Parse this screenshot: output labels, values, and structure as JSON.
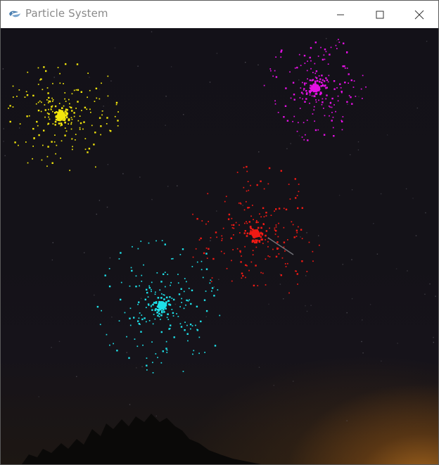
{
  "window": {
    "title": "Particle System",
    "icon": "python-icon",
    "controls": [
      "minimize-icon",
      "maximize-icon",
      "close-icon"
    ]
  },
  "scene": {
    "background": "#141218",
    "glow_color": "#b8702a",
    "fireworks": [
      {
        "name": "yellow-firework",
        "color": "#f2e60c"
      },
      {
        "name": "magenta-firework",
        "color": "#e510e5"
      },
      {
        "name": "red-firework",
        "color": "#f01a14"
      },
      {
        "name": "cyan-firework",
        "color": "#1ee0e8"
      }
    ]
  }
}
